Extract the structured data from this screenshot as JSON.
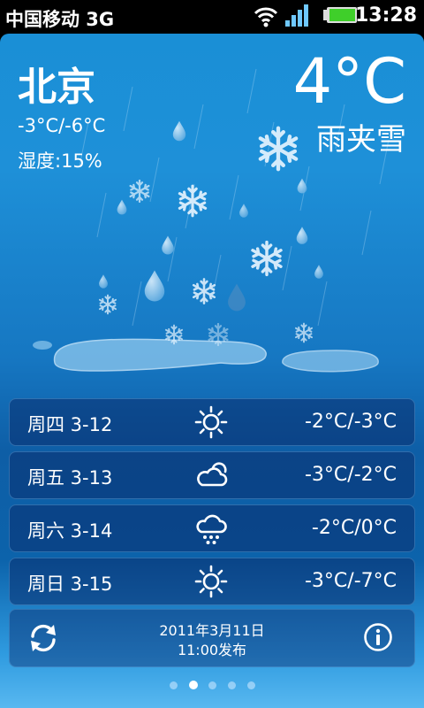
{
  "status_bar": {
    "carrier": "中国移动 3G",
    "time": "13:28",
    "icons": [
      "wifi-icon",
      "signal-icon",
      "battery-icon"
    ]
  },
  "weather": {
    "city": "北京",
    "temp_range": "-3°C/-6°C",
    "humidity_label": "湿度:",
    "humidity_value": "15%",
    "current_temp": "4°C",
    "condition": "雨夹雪",
    "illustration": "sleet-scene"
  },
  "forecast": [
    {
      "day": "周四 3-12",
      "icon": "sunny-icon",
      "temp": "-2°C/-3°C"
    },
    {
      "day": "周五 3-13",
      "icon": "cloudy-icon",
      "temp": "-3°C/-2°C"
    },
    {
      "day": "周六 3-14",
      "icon": "snow-icon",
      "temp": "-2°C/0°C"
    },
    {
      "day": "周日 3-15",
      "icon": "sunny-icon",
      "temp": "-3°C/-7°C"
    }
  ],
  "footer": {
    "published_date": "2011年3月11日",
    "published_time": "11:00发布",
    "refresh_icon": "refresh-icon",
    "info_icon": "info-icon"
  },
  "pager": {
    "count": 5,
    "active_index": 1
  },
  "colors": {
    "sky_top": "#1e90d8",
    "sky_deep": "#0e5ea6",
    "row_bg": "#0a2d6e",
    "text": "#ffffff"
  }
}
